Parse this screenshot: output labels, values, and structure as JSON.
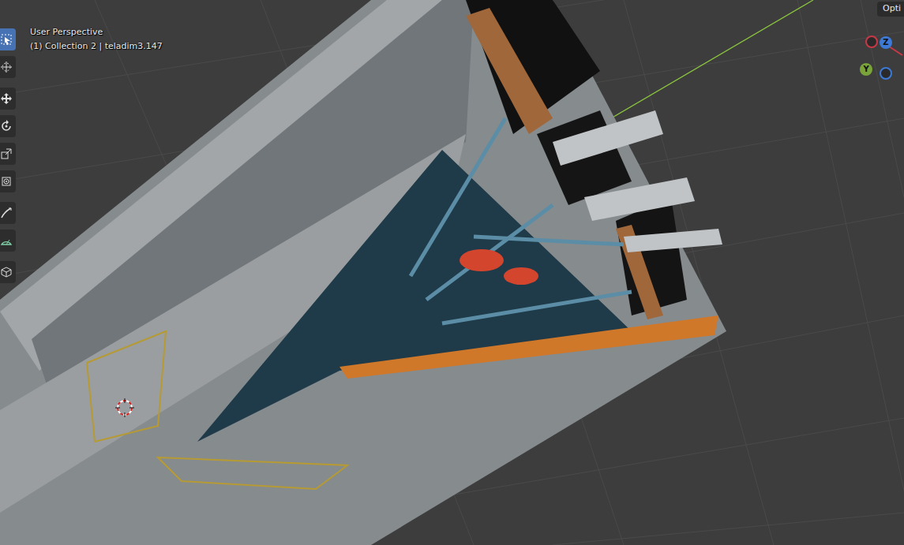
{
  "viewport": {
    "view_name": "User Perspective",
    "context": "(1) Collection 2 | teladim3.147"
  },
  "header_button": {
    "label": "Opti"
  },
  "toolbar": {
    "tools": [
      {
        "kind": "select",
        "selected": true
      },
      {
        "kind": "cursor",
        "selected": false
      },
      {
        "kind": "move",
        "selected": false
      },
      {
        "kind": "rotate",
        "selected": false
      },
      {
        "kind": "scale",
        "selected": false
      },
      {
        "kind": "transform",
        "selected": false
      },
      {
        "kind": "annotate",
        "selected": false
      },
      {
        "kind": "measure",
        "selected": false
      },
      {
        "kind": "addcube",
        "selected": false
      }
    ]
  },
  "gizmo": {
    "axes": [
      {
        "label": "Z",
        "color": "#3d7ad8"
      },
      {
        "label": "Y",
        "color": "#7aa43a"
      }
    ],
    "rings": [
      {
        "color": "#c83846"
      },
      {
        "color": "#3d7ad8"
      }
    ]
  }
}
